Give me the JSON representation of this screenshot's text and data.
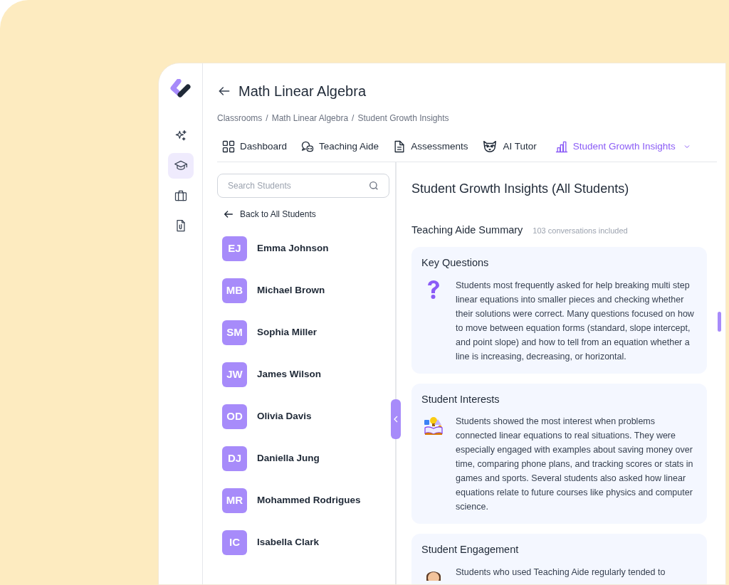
{
  "page": {
    "title": "Math Linear Algebra"
  },
  "breadcrumb": {
    "separator": "/",
    "items": [
      "Classrooms",
      "Math Linear Algebra",
      "Student Growth Insights"
    ]
  },
  "sidebar": {
    "items": [
      {
        "selected": false
      },
      {
        "selected": true
      },
      {
        "selected": false
      },
      {
        "selected": false
      }
    ]
  },
  "tabs": [
    {
      "label": "Dashboard",
      "selected": false
    },
    {
      "label": "Teaching Aide",
      "selected": false
    },
    {
      "label": "Assessments",
      "selected": false
    },
    {
      "label": "AI Tutor",
      "selected": false
    },
    {
      "label": "Student Growth Insights",
      "selected": true,
      "dropdown": true
    }
  ],
  "search": {
    "placeholder": "Search Students"
  },
  "back_link": "Back to All Students",
  "students": [
    {
      "initials": "EJ",
      "name": "Emma Johnson"
    },
    {
      "initials": "MB",
      "name": "Michael Brown"
    },
    {
      "initials": "SM",
      "name": "Sophia Miller"
    },
    {
      "initials": "JW",
      "name": "James Wilson"
    },
    {
      "initials": "OD",
      "name": "Olivia Davis"
    },
    {
      "initials": "DJ",
      "name": "Daniella Jung"
    },
    {
      "initials": "MR",
      "name": "Mohammed Rodrigues"
    },
    {
      "initials": "IC",
      "name": "Isabella Clark"
    }
  ],
  "insights": {
    "title": "Student Growth Insights (All Students)",
    "section_title": "Teaching Aide Summary",
    "section_note": "103 conversations included",
    "cards": [
      {
        "kind": "question",
        "title": "Key Questions",
        "text": "Students most frequently asked for help breaking multi step linear equations into smaller pieces and checking whether their solutions were correct. Many questions focused on how to move between equation forms (standard, slope intercept, and point slope) and how to tell from an equation whether a line is increasing, decreasing, or horizontal."
      },
      {
        "kind": "interest",
        "title": "Student Interests",
        "text": "Students showed the most interest when problems connected linear equations to real situations. They were especially engaged with examples about saving money over time, comparing phone plans, and tracking scores or stats in games and sports. Several students also asked how linear equations relate to future courses like physics and computer science."
      },
      {
        "kind": "engagement",
        "title": "Student Engagement",
        "text": "Students who used Teaching Aide regularly tended to"
      }
    ]
  }
}
